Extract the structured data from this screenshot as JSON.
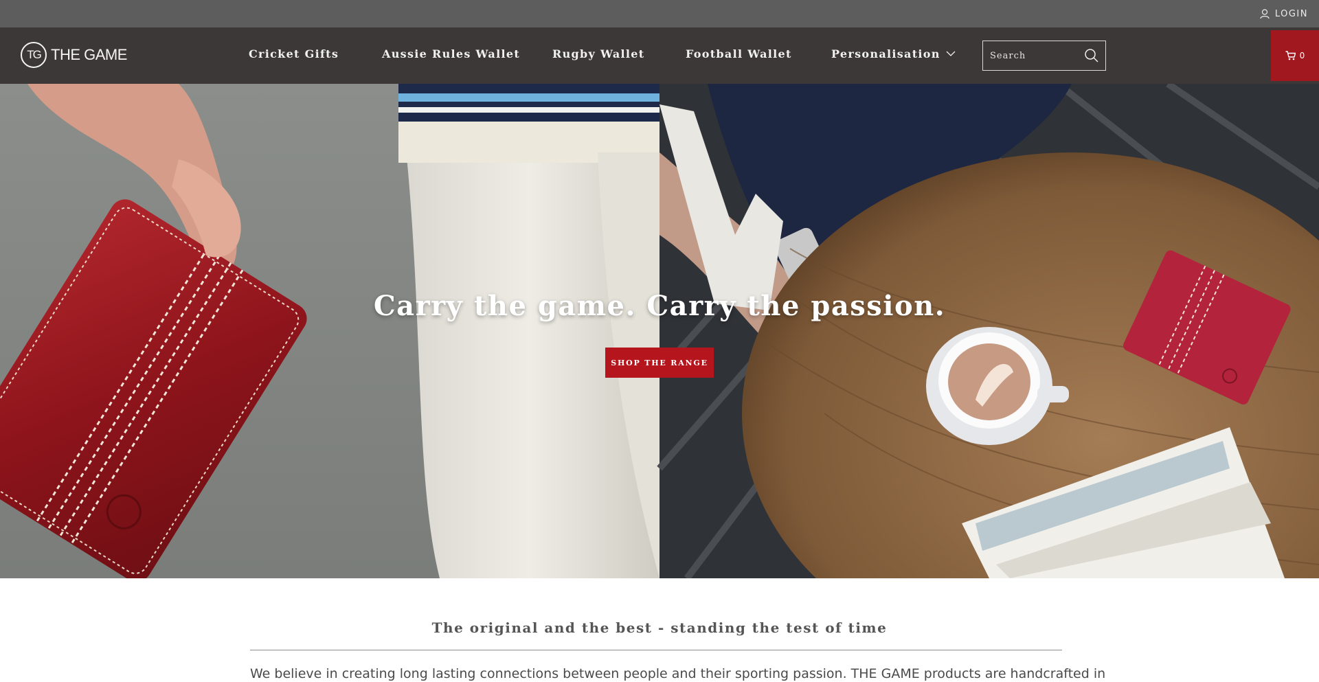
{
  "topbar": {
    "login_label": "LOGIN",
    "login_icon": "user-icon"
  },
  "header": {
    "logo_mark": "TG",
    "logo_text": "THE GAME",
    "nav": [
      {
        "label": "Cricket Gifts"
      },
      {
        "label": "Aussie Rules Wallet"
      },
      {
        "label": "Rugby Wallet"
      },
      {
        "label": "Football Wallet"
      },
      {
        "label": "Personalisation",
        "has_dropdown": true
      }
    ],
    "search": {
      "placeholder": "Search",
      "icon": "search-icon"
    },
    "cart": {
      "icon": "cart-icon",
      "count": "0"
    }
  },
  "hero": {
    "title": "Carry the game. Carry the passion.",
    "button_label": "SHOP THE RANGE"
  },
  "content": {
    "heading": "The original and the best - standing the test of time",
    "text": "We believe in creating long lasting connections between people and their sporting passion. THE GAME products are handcrafted in"
  },
  "colors": {
    "topbar": "#5d5d5d",
    "header": "#3c3838",
    "accent_red": "#b5161d",
    "cart_red": "#a1191f"
  }
}
